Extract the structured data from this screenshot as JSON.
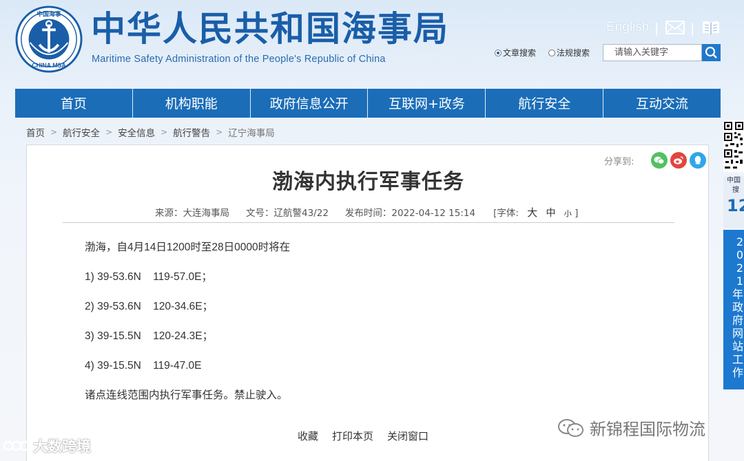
{
  "header": {
    "site_title": "中华人民共和国海事局",
    "site_subtitle": "Maritime Safety Administration of the People's Republic of China",
    "emblem_top_text": "中国海事",
    "emblem_bottom_text": "CHINA MSA",
    "lang_link": "English",
    "icons": [
      "mail-icon",
      "book-icon",
      "search-icon"
    ],
    "search": {
      "options": [
        {
          "label": "文章搜索",
          "selected": true
        },
        {
          "label": "法规搜索",
          "selected": false
        }
      ],
      "placeholder": "请输入关键字"
    }
  },
  "nav": {
    "items": [
      "首页",
      "机构职能",
      "政府信息公开",
      "互联网+政务",
      "航行安全",
      "互动交流"
    ]
  },
  "breadcrumb": [
    "首页",
    "航行安全",
    "安全信息",
    "航行警告",
    "辽宁海事局"
  ],
  "article": {
    "share_label": "分享到:",
    "share_icons": [
      "wechat-icon",
      "weibo-icon",
      "qq-icon"
    ],
    "title": "渤海内执行军事任务",
    "meta": {
      "source": "来源：大连海事局",
      "doc_no": "文号：辽航警43/22",
      "publish_time": "发布时间：2022-04-12 15:14",
      "font_label": "[字体:",
      "font_sizes": [
        "大",
        "中",
        "小"
      ],
      "font_close": "]"
    },
    "paragraphs": [
      "渤海，自4月14日1200时至28日0000时将在",
      "1) 39-53.6N    119-57.0E；",
      "2) 39-53.6N    120-34.6E；",
      "3) 39-15.5N    120-24.3E；",
      "4) 39-15.5N    119-47.0E",
      "诸点连线范围内执行军事任务。禁止驶入。"
    ],
    "actions": [
      "收藏",
      "打印本页",
      "关闭窗口"
    ]
  },
  "side": {
    "banner_top_small": [
      "中国",
      "搜"
    ],
    "banner_top_big": "12",
    "banner_chars": [
      "2",
      "0",
      "2",
      "1",
      "年",
      "政",
      "府",
      "网",
      "站",
      "工",
      "作"
    ]
  },
  "watermarks": {
    "left": "大数跨境",
    "right": "新锦程国际物流"
  },
  "colors": {
    "brand_blue": "#1b6db8",
    "title_blue": "#1a5ea8",
    "weibo_red": "#e2463d",
    "wechat_green": "#52c160",
    "qq_blue": "#2ea7e8"
  }
}
